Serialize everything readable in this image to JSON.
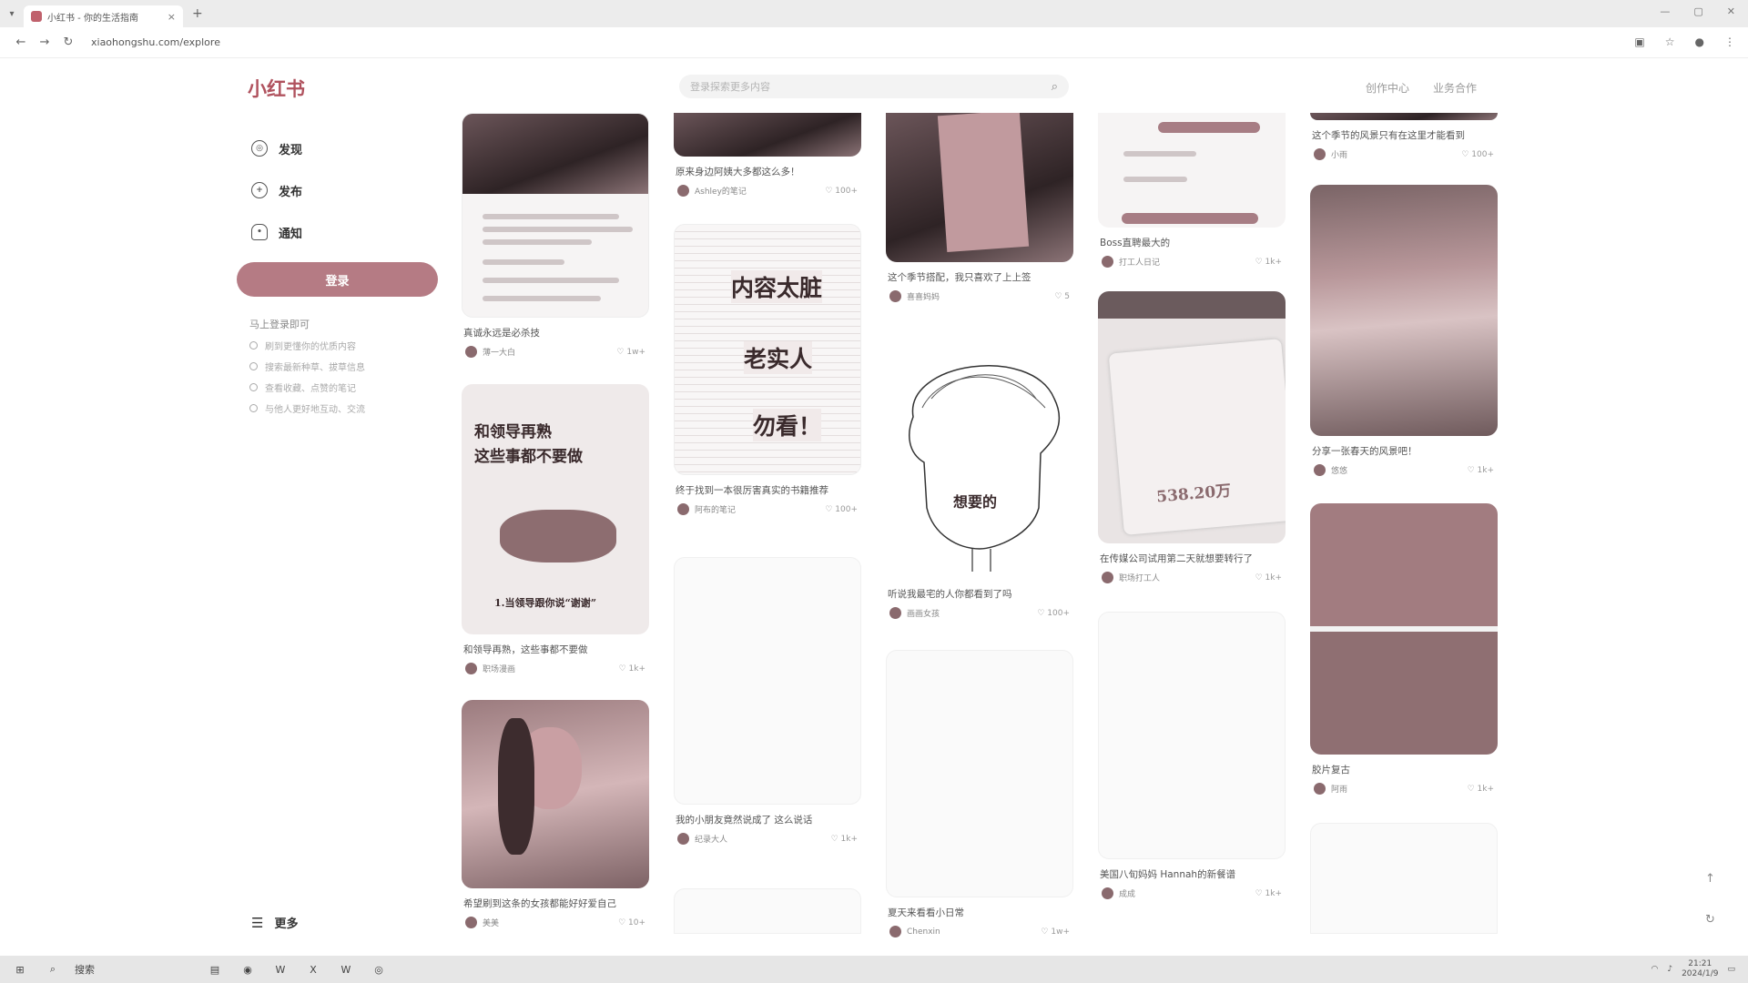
{
  "browser": {
    "tab_title": "小红书 - 你的生活指南",
    "url": "xiaohongshu.com/explore",
    "new_tab": "+",
    "close": "×"
  },
  "header": {
    "logo": "小红书",
    "search_placeholder": "登录探索更多内容",
    "nav": [
      "创作中心",
      "业务合作"
    ]
  },
  "sidebar": {
    "items": [
      {
        "label": "发现",
        "icon": "compass-icon"
      },
      {
        "label": "发布",
        "icon": "plus-circle-icon"
      },
      {
        "label": "通知",
        "icon": "bell-icon"
      }
    ],
    "login_label": "登录",
    "tips_title": "马上登录即可",
    "tips": [
      "刷到更懂你的优质内容",
      "搜索最新种草、拔草信息",
      "查看收藏、点赞的笔记",
      "与他人更好地互动、交流"
    ],
    "more_label": "更多"
  },
  "feed": {
    "col1": [
      {
        "caption": "真诚永远是必杀技",
        "author": "薄一大白",
        "likes": "1w+"
      },
      {
        "caption": "和领导再熟，这些事都不要做",
        "author": "职场漫画",
        "likes": "1k+",
        "overlay_title": "和领导再熟\n这些事都不要做",
        "overlay_sub": "1.当领导跟你说“谢谢”"
      },
      {
        "caption": "希望刷到这条的女孩都能好好爱自己",
        "author": "美美",
        "likes": "10+"
      }
    ],
    "col2": [
      {
        "caption": "原来身边阿姨大多都这么多！",
        "author": "Ashley的笔记",
        "likes": "100+"
      },
      {
        "caption": "终于找到一本很厉害真实的书籍推荐",
        "author": "阿布的笔记",
        "likes": "100+",
        "overlay_lines": [
          "内容太脏",
          "老实人",
          "勿看！"
        ]
      },
      {
        "caption": "我的小朋友竟然说成了 这么说话",
        "author": "纪录大人",
        "likes": "1k+"
      }
    ],
    "col3": [
      {
        "caption": "这个季节搭配，我只喜欢了上上签",
        "author": "喜喜妈妈",
        "likes": "5"
      },
      {
        "caption": "听说我最宅的人你都看到了吗",
        "author": "画画女孩",
        "likes": "100+",
        "overlay": "想要的"
      },
      {
        "caption": "夏天来看看小日常",
        "author": "Chenxin",
        "likes": "1w+"
      }
    ],
    "col4": [
      {
        "caption": "Boss直聘最大的",
        "author": "打工人日记",
        "likes": "1k+"
      },
      {
        "caption": "在传媒公司试用第二天就想要转行了",
        "author": "职场打工人",
        "likes": "1k+",
        "overlay_number": "538.20万"
      },
      {
        "caption": "美国八旬妈妈 Hannah的新餐谱",
        "author": "成成",
        "likes": "1k+"
      }
    ],
    "col5": [
      {
        "caption": "这个季节的风景只有在这里才能看到",
        "author": "小雨",
        "likes": "100+"
      },
      {
        "caption": "分享一张春天的风景吧！",
        "author": "悠悠",
        "likes": "1k+"
      },
      {
        "caption": "胶片复古",
        "author": "阿雨",
        "likes": "1k+"
      }
    ]
  },
  "taskbar": {
    "search": "搜索",
    "time": "21:21",
    "date": "2024/1/9"
  },
  "colors": {
    "brand": "#b0525e",
    "login_button": "#b57b84"
  }
}
